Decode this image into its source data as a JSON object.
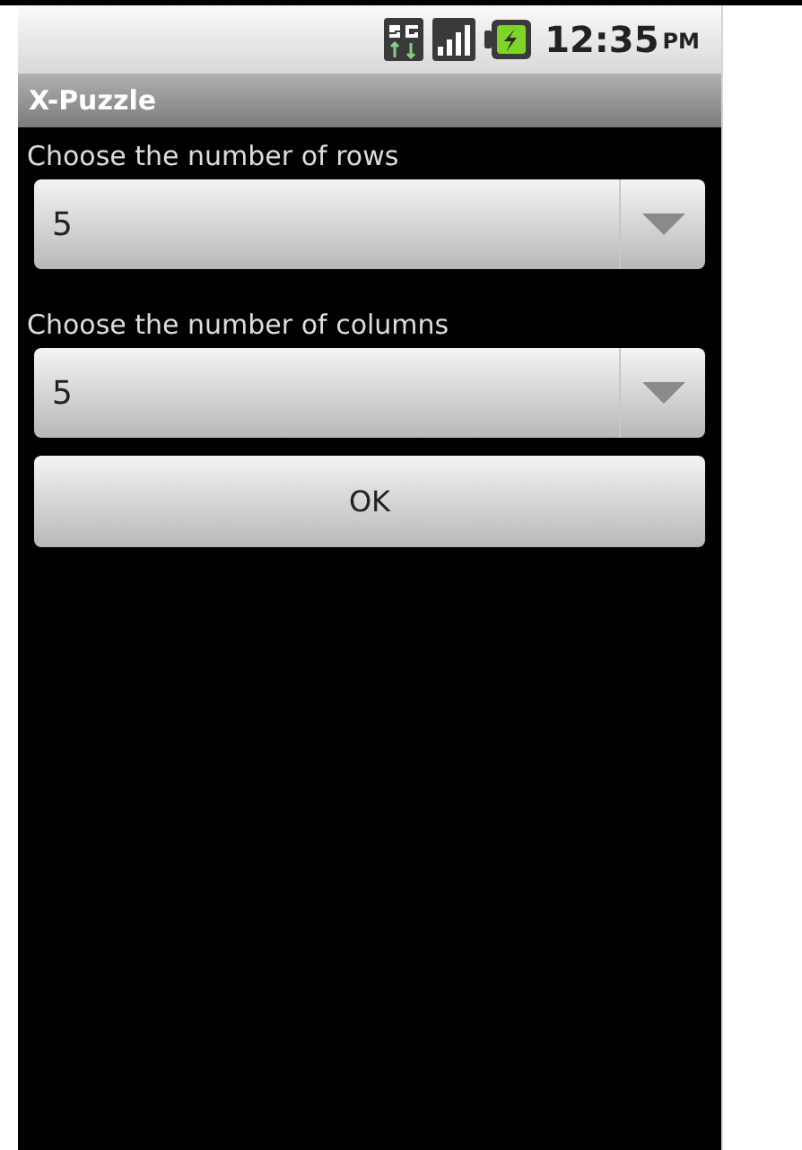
{
  "status_bar": {
    "time": "12:35",
    "ampm": "PM"
  },
  "title": "X-Puzzle",
  "fields": [
    {
      "label": "Choose the number of rows",
      "value": "5"
    },
    {
      "label": "Choose the number of columns",
      "value": "5"
    }
  ],
  "buttons": [
    "OK"
  ]
}
